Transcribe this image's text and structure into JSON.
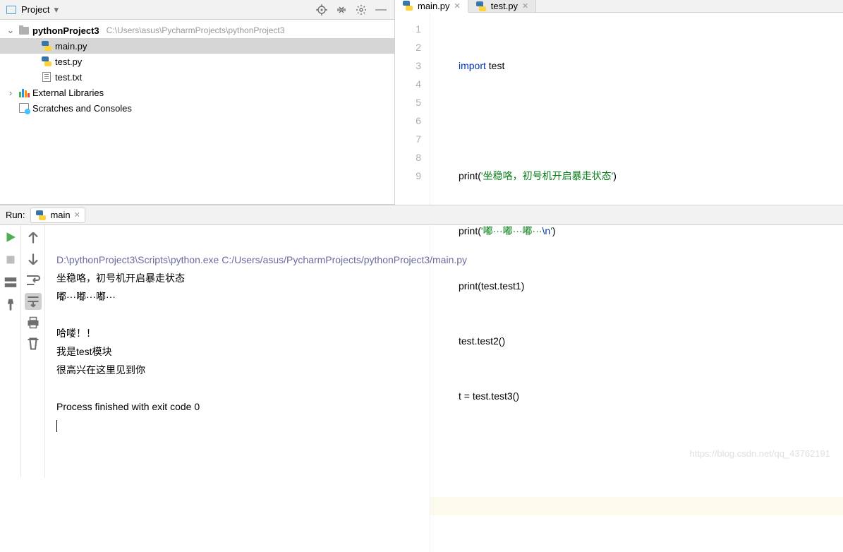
{
  "project_panel": {
    "title": "Project",
    "root": {
      "name": "pythonProject3",
      "path": "C:\\Users\\asus\\PycharmProjects\\pythonProject3"
    },
    "files": [
      "main.py",
      "test.py",
      "test.txt"
    ],
    "external_libs": "External Libraries",
    "scratches": "Scratches and Consoles"
  },
  "editor": {
    "tabs": [
      {
        "name": "main.py",
        "active": true
      },
      {
        "name": "test.py",
        "active": false
      }
    ],
    "line_count": 9,
    "code": {
      "l1": {
        "kw": "import ",
        "rest": "test"
      },
      "l3": {
        "fn": "print",
        "open": "(",
        "str": "'坐稳咯，初号机开启暴走状态'",
        "close": ")"
      },
      "l4": {
        "fn": "print",
        "open": "(",
        "str_a": "'嘟···嘟···嘟···",
        "esc": "\\n",
        "str_b": "'",
        "close": ")"
      },
      "l5": {
        "fn": "print",
        "open": "(",
        "arg": "test.test1",
        "close": ")"
      },
      "l6": "test.test2()",
      "l7": "t = test.test3()"
    }
  },
  "run": {
    "label": "Run:",
    "tab_name": "main",
    "command": "D:\\pythonProject3\\Scripts\\python.exe C:/Users/asus/PycharmProjects/pythonProject3/main.py",
    "output": [
      "坐稳咯，初号机开启暴走状态",
      "嘟···嘟···嘟···",
      "",
      "哈喽！！",
      "我是test模块",
      "很高兴在这里见到你",
      ""
    ],
    "exit_line": "Process finished with exit code 0"
  },
  "watermark": "https://blog.csdn.net/qq_43762191"
}
